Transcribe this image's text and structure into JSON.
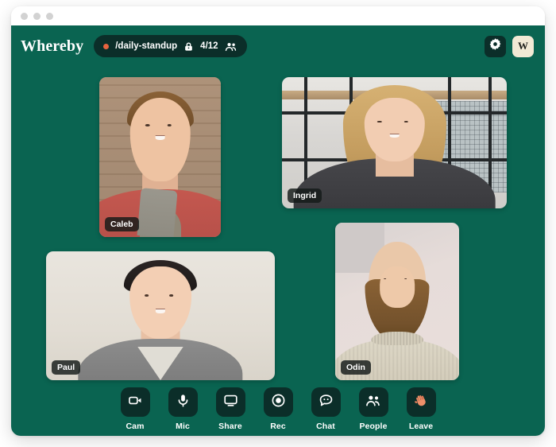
{
  "window": {
    "traffic_lights": [
      "close",
      "minimize",
      "maximize"
    ]
  },
  "header": {
    "brand": "Whereby",
    "room": {
      "status_dot_color": "#e8633f",
      "name": "/daily-standup",
      "lock_icon": "lock-icon",
      "participant_count": "4/12",
      "people_icon": "people-icon"
    },
    "settings_label": "Settings",
    "settings_icon": "gear-icon",
    "avatar_initial": "W"
  },
  "participants": [
    {
      "id": "caleb",
      "name": "Caleb"
    },
    {
      "id": "ingrid",
      "name": "Ingrid"
    },
    {
      "id": "paul",
      "name": "Paul"
    },
    {
      "id": "odin",
      "name": "Odin"
    }
  ],
  "toolbar": [
    {
      "id": "cam",
      "label": "Cam",
      "icon": "video-camera-icon"
    },
    {
      "id": "mic",
      "label": "Mic",
      "icon": "microphone-icon"
    },
    {
      "id": "share",
      "label": "Share",
      "icon": "screen-share-icon"
    },
    {
      "id": "rec",
      "label": "Rec",
      "icon": "record-dot-icon"
    },
    {
      "id": "chat",
      "label": "Chat",
      "icon": "chat-bubble-icon"
    },
    {
      "id": "people",
      "label": "People",
      "icon": "people-icon"
    },
    {
      "id": "leave",
      "label": "Leave",
      "icon": "waving-hand-icon"
    }
  ],
  "colors": {
    "stage_green": "#0a6451",
    "button_dark": "#0b2e29",
    "avatar_cream": "#f2e9d5",
    "accent_orange": "#e8633f",
    "leave_hand": "#e8835f"
  }
}
